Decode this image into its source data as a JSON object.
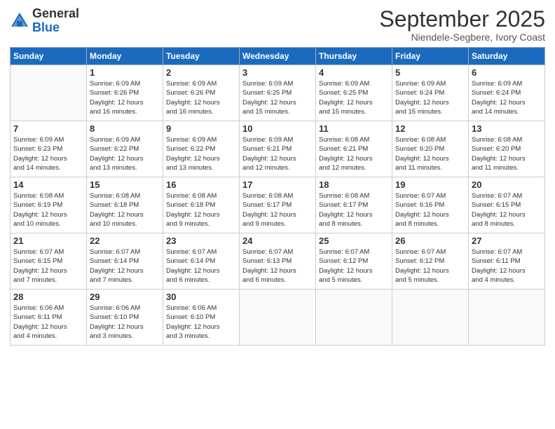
{
  "header": {
    "logo_general": "General",
    "logo_blue": "Blue",
    "month_title": "September 2025",
    "location": "Niendele-Segbere, Ivory Coast"
  },
  "days_of_week": [
    "Sunday",
    "Monday",
    "Tuesday",
    "Wednesday",
    "Thursday",
    "Friday",
    "Saturday"
  ],
  "weeks": [
    [
      {
        "day": "",
        "info": ""
      },
      {
        "day": "1",
        "info": "Sunrise: 6:09 AM\nSunset: 6:26 PM\nDaylight: 12 hours\nand 16 minutes."
      },
      {
        "day": "2",
        "info": "Sunrise: 6:09 AM\nSunset: 6:26 PM\nDaylight: 12 hours\nand 16 minutes."
      },
      {
        "day": "3",
        "info": "Sunrise: 6:09 AM\nSunset: 6:25 PM\nDaylight: 12 hours\nand 15 minutes."
      },
      {
        "day": "4",
        "info": "Sunrise: 6:09 AM\nSunset: 6:25 PM\nDaylight: 12 hours\nand 15 minutes."
      },
      {
        "day": "5",
        "info": "Sunrise: 6:09 AM\nSunset: 6:24 PM\nDaylight: 12 hours\nand 15 minutes."
      },
      {
        "day": "6",
        "info": "Sunrise: 6:09 AM\nSunset: 6:24 PM\nDaylight: 12 hours\nand 14 minutes."
      }
    ],
    [
      {
        "day": "7",
        "info": "Sunrise: 6:09 AM\nSunset: 6:23 PM\nDaylight: 12 hours\nand 14 minutes."
      },
      {
        "day": "8",
        "info": "Sunrise: 6:09 AM\nSunset: 6:22 PM\nDaylight: 12 hours\nand 13 minutes."
      },
      {
        "day": "9",
        "info": "Sunrise: 6:09 AM\nSunset: 6:22 PM\nDaylight: 12 hours\nand 13 minutes."
      },
      {
        "day": "10",
        "info": "Sunrise: 6:09 AM\nSunset: 6:21 PM\nDaylight: 12 hours\nand 12 minutes."
      },
      {
        "day": "11",
        "info": "Sunrise: 6:08 AM\nSunset: 6:21 PM\nDaylight: 12 hours\nand 12 minutes."
      },
      {
        "day": "12",
        "info": "Sunrise: 6:08 AM\nSunset: 6:20 PM\nDaylight: 12 hours\nand 11 minutes."
      },
      {
        "day": "13",
        "info": "Sunrise: 6:08 AM\nSunset: 6:20 PM\nDaylight: 12 hours\nand 11 minutes."
      }
    ],
    [
      {
        "day": "14",
        "info": "Sunrise: 6:08 AM\nSunset: 6:19 PM\nDaylight: 12 hours\nand 10 minutes."
      },
      {
        "day": "15",
        "info": "Sunrise: 6:08 AM\nSunset: 6:18 PM\nDaylight: 12 hours\nand 10 minutes."
      },
      {
        "day": "16",
        "info": "Sunrise: 6:08 AM\nSunset: 6:18 PM\nDaylight: 12 hours\nand 9 minutes."
      },
      {
        "day": "17",
        "info": "Sunrise: 6:08 AM\nSunset: 6:17 PM\nDaylight: 12 hours\nand 9 minutes."
      },
      {
        "day": "18",
        "info": "Sunrise: 6:08 AM\nSunset: 6:17 PM\nDaylight: 12 hours\nand 8 minutes."
      },
      {
        "day": "19",
        "info": "Sunrise: 6:07 AM\nSunset: 6:16 PM\nDaylight: 12 hours\nand 8 minutes."
      },
      {
        "day": "20",
        "info": "Sunrise: 6:07 AM\nSunset: 6:15 PM\nDaylight: 12 hours\nand 8 minutes."
      }
    ],
    [
      {
        "day": "21",
        "info": "Sunrise: 6:07 AM\nSunset: 6:15 PM\nDaylight: 12 hours\nand 7 minutes."
      },
      {
        "day": "22",
        "info": "Sunrise: 6:07 AM\nSunset: 6:14 PM\nDaylight: 12 hours\nand 7 minutes."
      },
      {
        "day": "23",
        "info": "Sunrise: 6:07 AM\nSunset: 6:14 PM\nDaylight: 12 hours\nand 6 minutes."
      },
      {
        "day": "24",
        "info": "Sunrise: 6:07 AM\nSunset: 6:13 PM\nDaylight: 12 hours\nand 6 minutes."
      },
      {
        "day": "25",
        "info": "Sunrise: 6:07 AM\nSunset: 6:12 PM\nDaylight: 12 hours\nand 5 minutes."
      },
      {
        "day": "26",
        "info": "Sunrise: 6:07 AM\nSunset: 6:12 PM\nDaylight: 12 hours\nand 5 minutes."
      },
      {
        "day": "27",
        "info": "Sunrise: 6:07 AM\nSunset: 6:11 PM\nDaylight: 12 hours\nand 4 minutes."
      }
    ],
    [
      {
        "day": "28",
        "info": "Sunrise: 6:06 AM\nSunset: 6:11 PM\nDaylight: 12 hours\nand 4 minutes."
      },
      {
        "day": "29",
        "info": "Sunrise: 6:06 AM\nSunset: 6:10 PM\nDaylight: 12 hours\nand 3 minutes."
      },
      {
        "day": "30",
        "info": "Sunrise: 6:06 AM\nSunset: 6:10 PM\nDaylight: 12 hours\nand 3 minutes."
      },
      {
        "day": "",
        "info": ""
      },
      {
        "day": "",
        "info": ""
      },
      {
        "day": "",
        "info": ""
      },
      {
        "day": "",
        "info": ""
      }
    ]
  ]
}
